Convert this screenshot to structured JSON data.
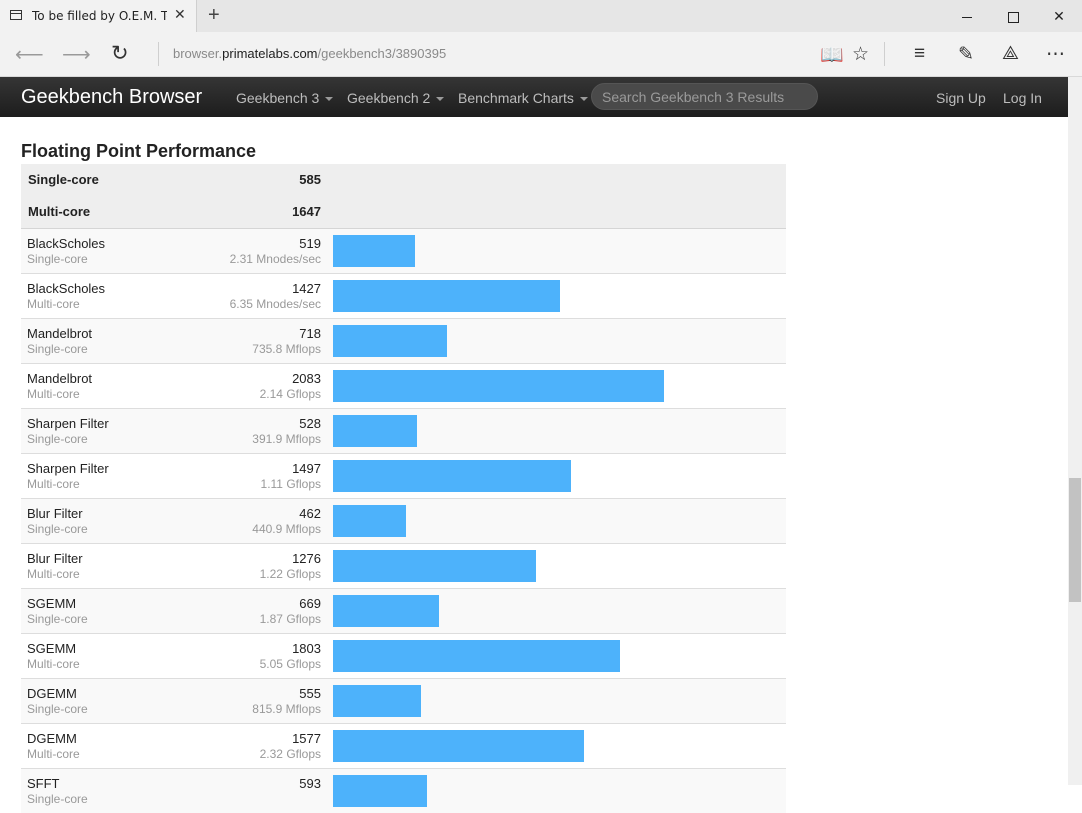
{
  "browser": {
    "tab_title": "To be filled by O.E.M. To",
    "url_prefix": "browser.",
    "url_domain": "primatelabs.com",
    "url_path": "/geekbench3/3890395"
  },
  "site": {
    "brand": "Geekbench Browser",
    "menu": [
      "Geekbench 3",
      "Geekbench 2",
      "Benchmark Charts"
    ],
    "search_placeholder": "Search Geekbench 3 Results",
    "sign_up": "Sign Up",
    "log_in": "Log In"
  },
  "section": {
    "title": "Floating Point Performance",
    "summary": [
      {
        "label": "Single-core",
        "value": "585"
      },
      {
        "label": "Multi-core",
        "value": "1647"
      }
    ],
    "rows": [
      {
        "name": "BlackScholes",
        "mode": "Single-core",
        "score": 519,
        "rate": "2.31 Mnodes/sec"
      },
      {
        "name": "BlackScholes",
        "mode": "Multi-core",
        "score": 1427,
        "rate": "6.35 Mnodes/sec"
      },
      {
        "name": "Mandelbrot",
        "mode": "Single-core",
        "score": 718,
        "rate": "735.8 Mflops"
      },
      {
        "name": "Mandelbrot",
        "mode": "Multi-core",
        "score": 2083,
        "rate": "2.14 Gflops"
      },
      {
        "name": "Sharpen Filter",
        "mode": "Single-core",
        "score": 528,
        "rate": "391.9 Mflops"
      },
      {
        "name": "Sharpen Filter",
        "mode": "Multi-core",
        "score": 1497,
        "rate": "1.11 Gflops"
      },
      {
        "name": "Blur Filter",
        "mode": "Single-core",
        "score": 462,
        "rate": "440.9 Mflops"
      },
      {
        "name": "Blur Filter",
        "mode": "Multi-core",
        "score": 1276,
        "rate": "1.22 Gflops"
      },
      {
        "name": "SGEMM",
        "mode": "Single-core",
        "score": 669,
        "rate": "1.87 Gflops"
      },
      {
        "name": "SGEMM",
        "mode": "Multi-core",
        "score": 1803,
        "rate": "5.05 Gflops"
      },
      {
        "name": "DGEMM",
        "mode": "Single-core",
        "score": 555,
        "rate": "815.9 Mflops"
      },
      {
        "name": "DGEMM",
        "mode": "Multi-core",
        "score": 1577,
        "rate": "2.32 Gflops"
      },
      {
        "name": "SFFT",
        "mode": "Single-core",
        "score": 593,
        "rate": ""
      }
    ]
  },
  "colors": {
    "bar": "#4db2fb",
    "header_bg": "#252525"
  },
  "icons": [
    "tab-page-icon",
    "close-icon",
    "new-tab-icon",
    "minimize-icon",
    "maximize-icon",
    "window-close-icon",
    "back-icon",
    "forward-icon",
    "refresh-icon",
    "reading-view-icon",
    "favorite-star-icon",
    "hub-icon",
    "web-note-icon",
    "share-icon",
    "more-icon"
  ]
}
